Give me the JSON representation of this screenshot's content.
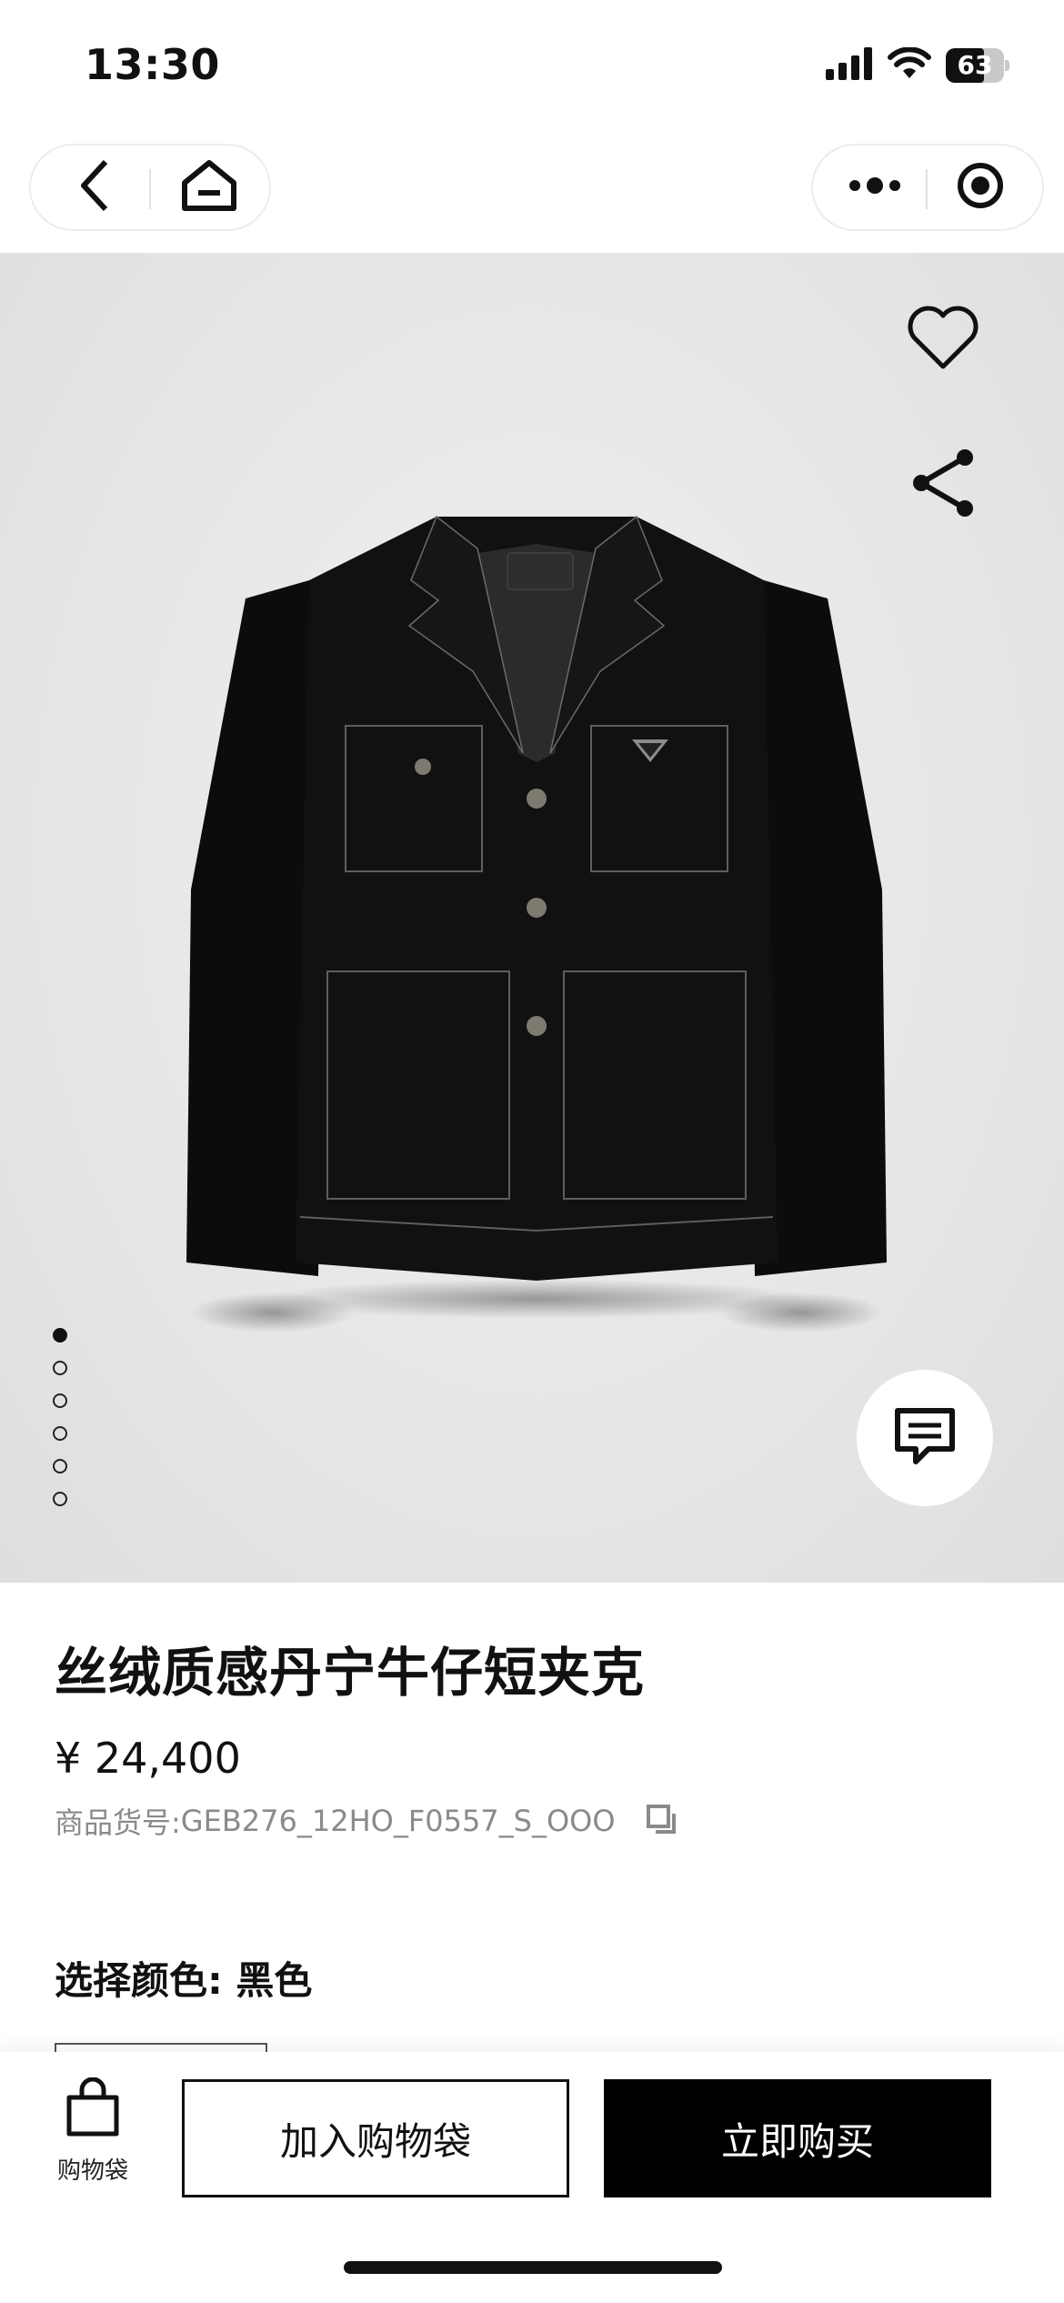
{
  "status_bar": {
    "time": "13:30",
    "battery_level": "63",
    "icons": [
      "cellular-signal-icon",
      "wifi-icon",
      "battery-icon"
    ]
  },
  "nav": {
    "left_icons": [
      "back-icon",
      "home-icon"
    ],
    "right_icons": [
      "more-icon",
      "mini-program-close-icon"
    ]
  },
  "gallery": {
    "image_count": 6,
    "active_index": 0,
    "actions": [
      "heart-icon",
      "share-icon"
    ],
    "chat_icon": "chat-icon"
  },
  "product": {
    "title": "丝绒质感丹宁牛仔短夹克",
    "price": "¥ 24,400",
    "sku_label": "商品货号: ",
    "sku_value": "GEB276_12HO_F0557_S_OOO",
    "color_label": "选择颜色: ",
    "color_value": "黑色"
  },
  "bottom_bar": {
    "bag_label": "购物袋",
    "add_to_bag": "加入购物袋",
    "buy_now": "立即购买"
  },
  "colors": {
    "primary": "#000000",
    "background": "#ffffff",
    "gallery_bg": "#e6e6e6",
    "muted_text": "#8a8a8a"
  }
}
